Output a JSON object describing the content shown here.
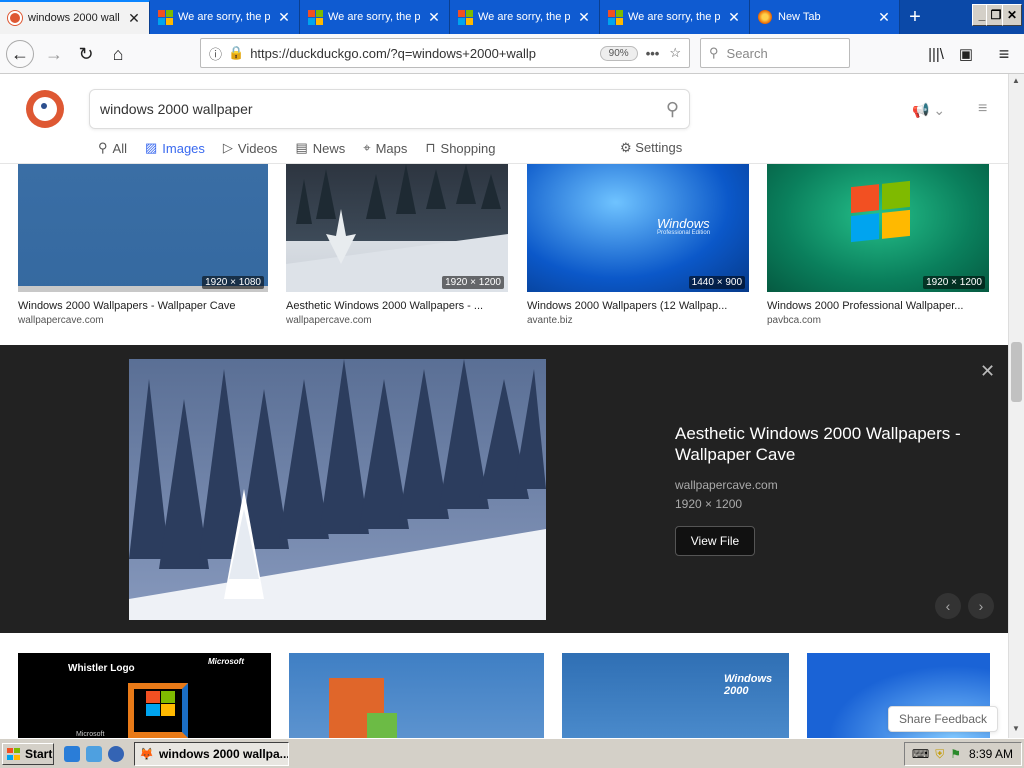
{
  "browser": {
    "tabs": [
      {
        "label": "windows 2000 wall",
        "icon": "duckduckgo-icon",
        "active": true
      },
      {
        "label": "We are sorry, the p",
        "icon": "microsoft-icon",
        "active": false
      },
      {
        "label": "We are sorry, the p",
        "icon": "microsoft-icon",
        "active": false
      },
      {
        "label": "We are sorry, the p",
        "icon": "microsoft-icon",
        "active": false
      },
      {
        "label": "We are sorry, the p",
        "icon": "microsoft-icon",
        "active": false
      },
      {
        "label": "New Tab",
        "icon": "firefox-icon",
        "active": false
      }
    ],
    "url": "https://duckduckgo.com/?q=windows+2000+wallp",
    "zoom": "90%",
    "search_placeholder": "Search"
  },
  "ddg": {
    "query": "windows 2000 wallpaper",
    "nav": [
      {
        "label": "All",
        "icon": "search-icon"
      },
      {
        "label": "Images",
        "icon": "image-icon"
      },
      {
        "label": "Videos",
        "icon": "video-icon"
      },
      {
        "label": "News",
        "icon": "news-icon"
      },
      {
        "label": "Maps",
        "icon": "map-pin-icon"
      },
      {
        "label": "Shopping",
        "icon": "shopping-bag-icon"
      }
    ],
    "settings_label": "Settings"
  },
  "results_row1": [
    {
      "title": "Windows 2000 Wallpapers - Wallpaper Cave",
      "source": "wallpapercave.com",
      "dims": "1920 × 1080"
    },
    {
      "title": "Aesthetic Windows 2000 Wallpapers - ...",
      "source": "wallpapercave.com",
      "dims": "1920 × 1200"
    },
    {
      "title": "Windows 2000 Wallpapers (12 Wallpap...",
      "source": "avante.biz",
      "dims": "1440 × 900"
    },
    {
      "title": "Windows 2000 Professional Wallpaper...",
      "source": "pavbca.com",
      "dims": "1920 × 1200"
    }
  ],
  "thumb_text": {
    "windows_logo_small": "Windows",
    "windows_logo_edition": "Professional Edition",
    "whistler_logo": "Whistler Logo",
    "microsoft": "Microsoft",
    "microsoft2": "Microsoft",
    "windows2000_brand": "Windows 2000"
  },
  "detail": {
    "title": "Aesthetic Windows 2000 Wallpapers - Wallpaper Cave",
    "source": "wallpapercave.com",
    "dims": "1920 × 1200",
    "button": "View File"
  },
  "feedback_label": "Share Feedback",
  "taskbar": {
    "start_label": "Start",
    "active_window": "windows 2000 wallpa...",
    "clock": "8:39 AM"
  }
}
